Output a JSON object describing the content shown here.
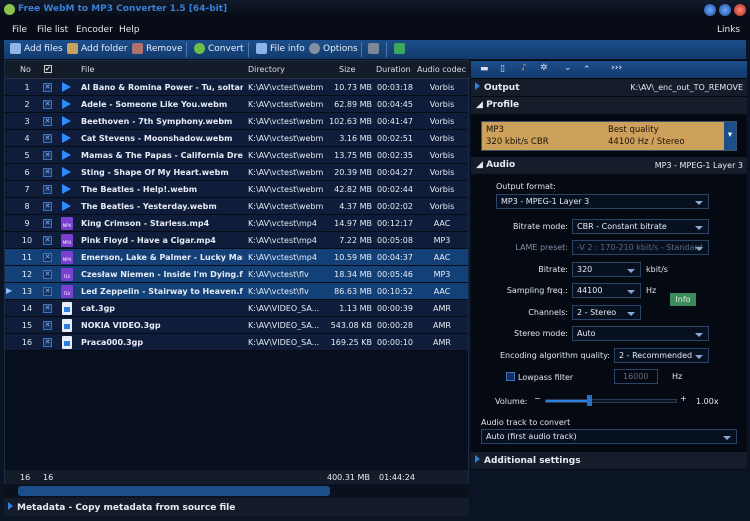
{
  "window": {
    "title": "Free WebM to MP3 Converter 1.5  [64-bit]"
  },
  "menu": [
    "File",
    "File list",
    "Encoder",
    "Help"
  ],
  "menu_right": "Links",
  "toolbar": {
    "add_files": "Add files",
    "add_folder": "Add folder",
    "remove": "Remove",
    "convert": "Convert",
    "file_info": "File info",
    "options": "Options"
  },
  "table": {
    "headers": {
      "no": "No",
      "file": "File",
      "directory": "Directory",
      "size": "Size",
      "duration": "Duration",
      "codec": "Audio codec"
    },
    "rows": [
      {
        "no": "1",
        "type": "webm",
        "file": "Al Bano & Romina Power - Tu, soltanto ...",
        "dir": "K:\\AV\\vctest\\webm",
        "size": "10.73 MB",
        "dur": "00:03:18",
        "codec": "Vorbis"
      },
      {
        "no": "2",
        "type": "webm",
        "file": "Adele - Someone Like You.webm",
        "dir": "K:\\AV\\vctest\\webm",
        "size": "62.89 MB",
        "dur": "00:04:45",
        "codec": "Vorbis"
      },
      {
        "no": "3",
        "type": "webm",
        "file": "Beethoven - 7th Symphony.webm",
        "dir": "K:\\AV\\vctest\\webm",
        "size": "102.63 MB",
        "dur": "00:41:47",
        "codec": "Vorbis"
      },
      {
        "no": "4",
        "type": "webm",
        "file": "Cat Stevens - Moonshadow.webm",
        "dir": "K:\\AV\\vctest\\webm",
        "size": "3.16 MB",
        "dur": "00:02:51",
        "codec": "Vorbis"
      },
      {
        "no": "5",
        "type": "webm",
        "file": "Mamas & The Papas - California Dreami...",
        "dir": "K:\\AV\\vctest\\webm",
        "size": "13.75 MB",
        "dur": "00:02:35",
        "codec": "Vorbis"
      },
      {
        "no": "6",
        "type": "webm",
        "file": "Sting - Shape Of My Heart.webm",
        "dir": "K:\\AV\\vctest\\webm",
        "size": "20.39 MB",
        "dur": "00:04:27",
        "codec": "Vorbis"
      },
      {
        "no": "7",
        "type": "webm",
        "file": "The Beatles - Help!.webm",
        "dir": "K:\\AV\\vctest\\webm",
        "size": "42.82 MB",
        "dur": "00:02:44",
        "codec": "Vorbis"
      },
      {
        "no": "8",
        "type": "webm",
        "file": "The Beatles - Yesterday.webm",
        "dir": "K:\\AV\\vctest\\webm",
        "size": "4.37 MB",
        "dur": "00:02:02",
        "codec": "Vorbis"
      },
      {
        "no": "9",
        "type": "mp4",
        "file": "King Crimson - Starless.mp4",
        "dir": "K:\\AV\\vctest\\mp4",
        "size": "14.97 MB",
        "dur": "00:12:17",
        "codec": "AAC"
      },
      {
        "no": "10",
        "type": "mp4",
        "file": "Pink Floyd - Have a Cigar.mp4",
        "dir": "K:\\AV\\vctest\\mp4",
        "size": "7.22 MB",
        "dur": "00:05:08",
        "codec": "MP3"
      },
      {
        "no": "11",
        "type": "mp4",
        "file": "Emerson, Lake & Palmer - Lucky Man.m...",
        "dir": "K:\\AV\\vctest\\mp4",
        "size": "10.59 MB",
        "dur": "00:04:37",
        "codec": "AAC",
        "selected": true
      },
      {
        "no": "12",
        "type": "flv",
        "file": "Czesław Niemen - Inside I'm Dying.flv",
        "dir": "K:\\AV\\vctest\\flv",
        "size": "18.34 MB",
        "dur": "00:05:46",
        "codec": "MP3",
        "selected": true
      },
      {
        "no": "13",
        "type": "flv",
        "file": "Led Zeppelin - Stairway to Heaven.flv",
        "dir": "K:\\AV\\vctest\\flv",
        "size": "86.63 MB",
        "dur": "00:10:52",
        "codec": "AAC",
        "selected": true,
        "current": true
      },
      {
        "no": "14",
        "type": "3gp",
        "file": "cat.3gp",
        "dir": "K:\\AV\\VIDEO_SA...",
        "size": "1.13 MB",
        "dur": "00:00:39",
        "codec": "AMR"
      },
      {
        "no": "15",
        "type": "3gp",
        "file": "NOKIA VIDEO.3gp",
        "dir": "K:\\AV\\VIDEO_SA...",
        "size": "543.08 KB",
        "dur": "00:00:28",
        "codec": "AMR"
      },
      {
        "no": "16",
        "type": "3gp",
        "file": "Praca000.3gp",
        "dir": "K:\\AV\\VIDEO_SA...",
        "size": "169.25 KB",
        "dur": "00:00:10",
        "codec": "AMR"
      }
    ],
    "footer": {
      "count": "16",
      "checked": "16",
      "total_size": "400.31 MB",
      "total_duration": "01:44:24"
    }
  },
  "metadata": "Metadata - Copy metadata from source file",
  "right": {
    "output": {
      "label": "Output",
      "path": "K:\\AV\\_enc_out_TO_REMOVE"
    },
    "profile": {
      "label": "Profile",
      "format": "MP3",
      "bitrate": "320 kbit/s CBR",
      "quality": "Best quality",
      "freq": "44100 Hz / Stereo"
    },
    "audio": {
      "label": "Audio",
      "summary": "MP3 - MPEG-1 Layer 3",
      "output_format_label": "Output format:",
      "output_format": "MP3 - MPEG-1 Layer 3",
      "bitrate_mode_label": "Bitrate mode:",
      "bitrate_mode": "CBR - Constant bitrate",
      "lame_label": "LAME preset:",
      "lame": "-V 2 : 170-210 kbit/s - Standard",
      "bitrate_label": "Bitrate:",
      "bitrate": "320",
      "bitrate_unit": "kbit/s",
      "freq_label": "Sampling freq.:",
      "freq": "44100",
      "freq_unit": "Hz",
      "info": "Info",
      "channels_label": "Channels:",
      "channels": "2 - Stereo",
      "stereo_label": "Stereo mode:",
      "stereo": "Auto",
      "quality_label": "Encoding algorithm quality:",
      "quality": "2 - Recommended",
      "lowpass_label": "Lowpass filter",
      "lowpass": "16000",
      "lowpass_unit": "Hz",
      "volume_label": "Volume:",
      "volume": "1.00x",
      "volume_fraction": 0.33,
      "track_label": "Audio track to convert",
      "track": "Auto (first audio track)"
    },
    "additional": "Additional settings"
  }
}
